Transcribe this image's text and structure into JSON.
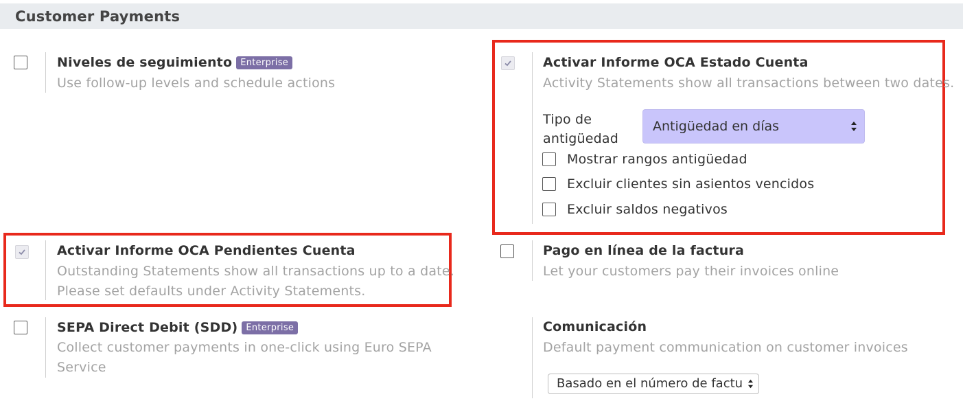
{
  "section": {
    "title": "Customer Payments"
  },
  "badges": {
    "enterprise": "Enterprise"
  },
  "settings": {
    "followup": {
      "label": "Niveles de seguimiento",
      "description": "Use follow-up levels and schedule actions",
      "checked": false
    },
    "activity_statement": {
      "label": "Activar Informe OCA Estado Cuenta",
      "description": "Activity Statements show all transactions between two dates.",
      "checked": true,
      "aging_type_label_line1": "Tipo de",
      "aging_type_label_line2": "antigüedad",
      "aging_type_value": "Antigüedad en días",
      "options": [
        {
          "label": "Mostrar rangos antigüedad",
          "checked": false
        },
        {
          "label": "Excluir clientes sin asientos vencidos",
          "checked": false
        },
        {
          "label": "Excluir saldos negativos",
          "checked": false
        }
      ]
    },
    "outstanding_statement": {
      "label": "Activar Informe OCA Pendientes Cuenta",
      "description_line1": "Outstanding Statements show all transactions up to a date.",
      "description_line2": "Please set defaults under Activity Statements.",
      "checked": true
    },
    "online_payment": {
      "label": "Pago en línea de la factura",
      "description": "Let your customers pay their invoices online",
      "checked": false
    },
    "sepa": {
      "label": "SEPA Direct Debit (SDD)",
      "description_line1": "Collect customer payments in one-click using Euro SEPA",
      "description_line2": "Service",
      "checked": false
    },
    "communication": {
      "label": "Comunicación",
      "description": "Default payment communication on customer invoices",
      "select_value": "Basado en el número de factura"
    }
  },
  "colors": {
    "highlight": "#e8291c",
    "badge": "#7c6fa6",
    "select_highlight": "#c9c5fb"
  }
}
